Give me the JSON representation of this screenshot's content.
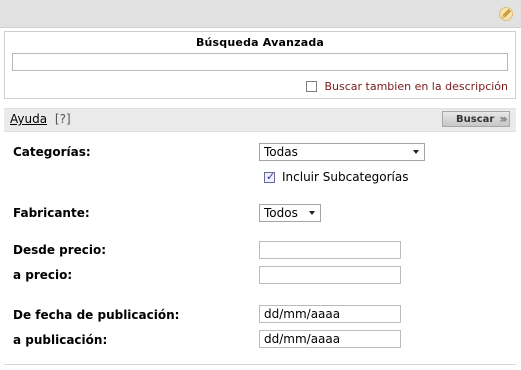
{
  "search": {
    "title": "Búsqueda Avanzada",
    "keywords_value": "",
    "desc_label": "Buscar tambien en la descripción",
    "desc_checked": false
  },
  "actionbar": {
    "help_label": "Ayuda",
    "help_q": "[?]",
    "search_button": "Buscar"
  },
  "filters": {
    "categories_label": "Categorías:",
    "categories_value": "Todas",
    "subcategories_label": "Incluir Subcategorías",
    "subcategories_checked": true,
    "manufacturer_label": "Fabricante:",
    "manufacturer_value": "Todos",
    "price_from_label": "Desde precio:",
    "price_from_value": "",
    "price_to_label": "a precio:",
    "price_to_value": "",
    "date_from_label": "De fecha de publicación:",
    "date_from_value": "dd/mm/aaaa",
    "date_to_label": "a publicación:",
    "date_to_value": "dd/mm/aaaa"
  },
  "icons": {
    "edit": "pencil-icon",
    "search_arrows": "double-chevron-right-icon"
  }
}
